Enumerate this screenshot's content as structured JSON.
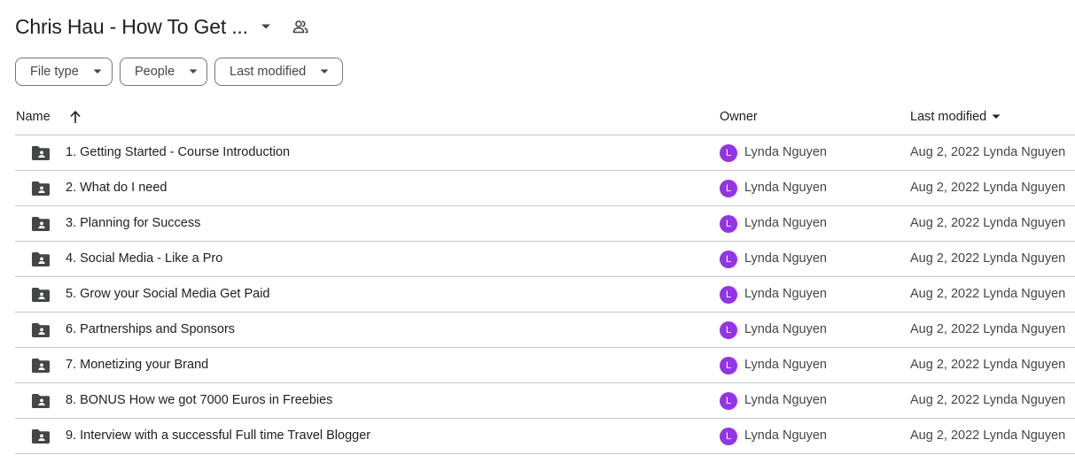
{
  "header": {
    "title": "Chris Hau - How To Get ...",
    "icons": {
      "title_caret": "arrow-drop-down-icon",
      "shared": "shared-people-icon"
    }
  },
  "filters": [
    {
      "label": "File type"
    },
    {
      "label": "People"
    },
    {
      "label": "Last modified"
    }
  ],
  "table": {
    "columns": {
      "name": "Name",
      "owner": "Owner",
      "modified": "Last modified"
    },
    "sort": {
      "name_direction": "ascending",
      "modified_indicator": "arrow-drop-down-icon"
    },
    "rows": [
      {
        "name": "1. Getting Started - Course Introduction",
        "owner_initial": "L",
        "owner": "Lynda Nguyen",
        "modified": "Aug 2, 2022 Lynda Nguyen"
      },
      {
        "name": "2. What do I need",
        "owner_initial": "L",
        "owner": "Lynda Nguyen",
        "modified": "Aug 2, 2022 Lynda Nguyen"
      },
      {
        "name": "3. Planning for Success",
        "owner_initial": "L",
        "owner": "Lynda Nguyen",
        "modified": "Aug 2, 2022 Lynda Nguyen"
      },
      {
        "name": "4. Social Media - Like a Pro",
        "owner_initial": "L",
        "owner": "Lynda Nguyen",
        "modified": "Aug 2, 2022 Lynda Nguyen"
      },
      {
        "name": "5. Grow your Social Media  Get Paid",
        "owner_initial": "L",
        "owner": "Lynda Nguyen",
        "modified": "Aug 2, 2022 Lynda Nguyen"
      },
      {
        "name": "6. Partnerships and Sponsors",
        "owner_initial": "L",
        "owner": "Lynda Nguyen",
        "modified": "Aug 2, 2022 Lynda Nguyen"
      },
      {
        "name": "7. Monetizing your Brand",
        "owner_initial": "L",
        "owner": "Lynda Nguyen",
        "modified": "Aug 2, 2022 Lynda Nguyen"
      },
      {
        "name": "8. BONUS How we got 7000 Euros in Freebies",
        "owner_initial": "L",
        "owner": "Lynda Nguyen",
        "modified": "Aug 2, 2022 Lynda Nguyen"
      },
      {
        "name": "9. Interview with a successful Full time Travel Blogger",
        "owner_initial": "L",
        "owner": "Lynda Nguyen",
        "modified": "Aug 2, 2022 Lynda Nguyen"
      }
    ]
  },
  "colors": {
    "avatar": "#9334e6",
    "divider": "#c7c7c7",
    "text": "#1f1f1f",
    "secondary_text": "#444746",
    "icon": "#444746"
  }
}
